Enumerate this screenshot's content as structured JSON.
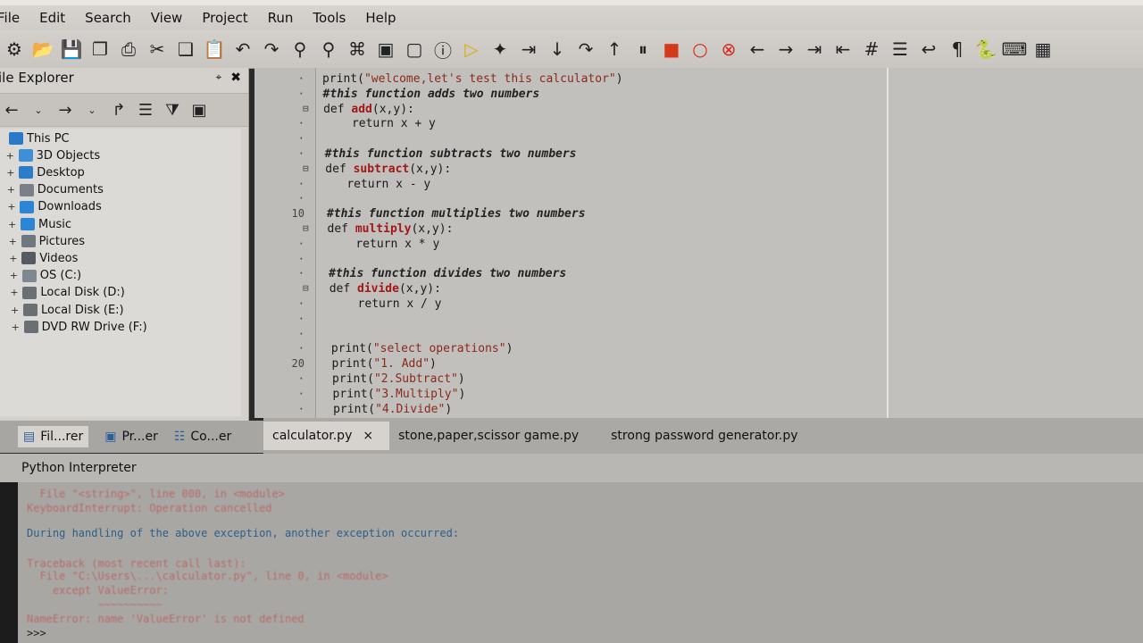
{
  "menu": [
    "File",
    "Edit",
    "Search",
    "View",
    "Project",
    "Run",
    "Tools",
    "Help"
  ],
  "toolbar_icons": [
    "new-project-icon",
    "open-icon",
    "save-icon",
    "save-all-icon",
    "print-icon",
    "cut-icon",
    "copy-icon",
    "paste-icon",
    "undo-icon",
    "redo-icon",
    "find-icon",
    "find-replace-icon",
    "find-in-files-icon",
    "screenshot-icon",
    "window-icon",
    "info-icon",
    "run-icon",
    "debug-icon",
    "step-icon",
    "step-into-icon",
    "step-over-icon",
    "step-out-icon",
    "pause-icon",
    "stop-icon",
    "breakpoint-icon",
    "clear-breakpoints-icon",
    "back-icon",
    "forward-icon",
    "indent-icon",
    "unindent-icon",
    "comment-icon",
    "list-icon",
    "wrap-icon",
    "pilcrow-icon",
    "python-icon",
    "keyboard-icon",
    "layout-icon"
  ],
  "explorer": {
    "title": "ile Explorer",
    "pin": "📌",
    "close": "✖",
    "tree": [
      {
        "label": "This PC",
        "depth": 0,
        "color": "#2a78c8"
      },
      {
        "label": "3D Objects",
        "depth": 1,
        "color": "#3c8fd8"
      },
      {
        "label": "Desktop",
        "depth": 1,
        "color": "#2d7cc8"
      },
      {
        "label": "Documents",
        "depth": 1,
        "color": "#7a7f88"
      },
      {
        "label": "Downloads",
        "depth": 1,
        "color": "#2b86d6"
      },
      {
        "label": "Music",
        "depth": 1,
        "color": "#2b86d6"
      },
      {
        "label": "Pictures",
        "depth": 1,
        "color": "#6f7780"
      },
      {
        "label": "Videos",
        "depth": 1,
        "color": "#555b60"
      },
      {
        "label": "OS (C:)",
        "depth": 1,
        "color": "#7f8890"
      },
      {
        "label": "Local Disk (D:)",
        "depth": 1,
        "color": "#6a6f74"
      },
      {
        "label": "Local Disk (E:)",
        "depth": 1,
        "color": "#6a6f74"
      },
      {
        "label": "DVD RW Drive (F:)",
        "depth": 1,
        "color": "#6a6f74"
      }
    ]
  },
  "editor": {
    "lines": [
      {
        "num": "",
        "fold": "",
        "parts": [
          [
            "print(",
            ""
          ],
          [
            "\"welcome,let's test this calculator\"",
            "str"
          ],
          [
            ")",
            ""
          ]
        ]
      },
      {
        "num": "",
        "fold": "",
        "parts": [
          [
            "#this function adds two numbers",
            "cmt"
          ]
        ]
      },
      {
        "num": "",
        "fold": "⊟",
        "parts": [
          [
            "def ",
            "kw"
          ],
          [
            "add",
            "fn"
          ],
          [
            "(x,y):",
            ""
          ]
        ]
      },
      {
        "num": "",
        "fold": "",
        "parts": [
          [
            "    return x + y",
            ""
          ]
        ]
      },
      {
        "num": "",
        "fold": "",
        "parts": [
          [
            "",
            ""
          ]
        ]
      },
      {
        "num": "",
        "fold": "",
        "parts": [
          [
            "#this function subtracts two numbers",
            "cmt"
          ]
        ]
      },
      {
        "num": "",
        "fold": "⊟",
        "parts": [
          [
            "def ",
            "kw"
          ],
          [
            "subtract",
            "fn"
          ],
          [
            "(x,y):",
            ""
          ]
        ]
      },
      {
        "num": "",
        "fold": "",
        "parts": [
          [
            "   return x - y",
            ""
          ]
        ]
      },
      {
        "num": "",
        "fold": "",
        "parts": [
          [
            "",
            ""
          ]
        ]
      },
      {
        "num": "10",
        "fold": "",
        "parts": [
          [
            "#this function multiplies two numbers",
            "cmt"
          ]
        ]
      },
      {
        "num": "",
        "fold": "⊟",
        "parts": [
          [
            "def ",
            "kw"
          ],
          [
            "multiply",
            "fn"
          ],
          [
            "(x,y):",
            ""
          ]
        ]
      },
      {
        "num": "",
        "fold": "",
        "parts": [
          [
            "    return x * y",
            ""
          ]
        ]
      },
      {
        "num": "",
        "fold": "",
        "parts": [
          [
            "",
            ""
          ]
        ]
      },
      {
        "num": "",
        "fold": "",
        "parts": [
          [
            "#this function divides two numbers",
            "cmt"
          ]
        ]
      },
      {
        "num": "",
        "fold": "⊟",
        "parts": [
          [
            "def ",
            "kw"
          ],
          [
            "divide",
            "fn"
          ],
          [
            "(x,y):",
            ""
          ]
        ]
      },
      {
        "num": "",
        "fold": "",
        "parts": [
          [
            "    return x / y",
            ""
          ]
        ]
      },
      {
        "num": "",
        "fold": "",
        "parts": [
          [
            "",
            ""
          ]
        ]
      },
      {
        "num": "",
        "fold": "",
        "parts": [
          [
            "",
            ""
          ]
        ]
      },
      {
        "num": "",
        "fold": "",
        "parts": [
          [
            "print(",
            ""
          ],
          [
            "\"select operations\"",
            "str"
          ],
          [
            ")",
            ""
          ]
        ]
      },
      {
        "num": "20",
        "fold": "",
        "parts": [
          [
            "print(",
            ""
          ],
          [
            "\"1. Add\"",
            "str"
          ],
          [
            ")",
            ""
          ]
        ]
      },
      {
        "num": "",
        "fold": "",
        "parts": [
          [
            "print(",
            ""
          ],
          [
            "\"2.Subtract\"",
            "str"
          ],
          [
            ")",
            ""
          ]
        ]
      },
      {
        "num": "",
        "fold": "",
        "parts": [
          [
            "print(",
            ""
          ],
          [
            "\"3.Multiply\"",
            "str"
          ],
          [
            ")",
            ""
          ]
        ]
      },
      {
        "num": "",
        "fold": "",
        "parts": [
          [
            "print(",
            ""
          ],
          [
            "\"4.Divide\"",
            "str"
          ],
          [
            ")",
            ""
          ]
        ]
      }
    ]
  },
  "left_tabs": [
    {
      "label": "Fil...rer",
      "icon": "file-explorer-icon",
      "active": true
    },
    {
      "label": "Pr...er",
      "icon": "project-icon",
      "active": false
    },
    {
      "label": "Co...er",
      "icon": "code-browser-icon",
      "active": false
    }
  ],
  "editor_tabs": [
    {
      "label": "calculator.py",
      "active": true,
      "close": "×"
    },
    {
      "label": "stone,paper,scissor game.py",
      "active": false,
      "close": ""
    },
    {
      "label": "strong password generator.py",
      "active": false,
      "close": ""
    }
  ],
  "interpreter": {
    "title": "Python Interpreter",
    "lines": [
      {
        "text": "  File \"<string>\", line 000, in <module>",
        "cls": "err"
      },
      {
        "text": "KeyboardInterrupt: Operation cancelled",
        "cls": "err"
      },
      {
        "text": "",
        "cls": ""
      },
      {
        "text": "During handling of the above exception, another exception occurred:",
        "cls": "info"
      },
      {
        "text": "",
        "cls": ""
      },
      {
        "text": "Traceback (most recent call last):",
        "cls": "err"
      },
      {
        "text": "  File \"C:\\Users\\...\\calculator.py\", line 0, in <module>",
        "cls": "err"
      },
      {
        "text": "    except ValueError:",
        "cls": "err"
      },
      {
        "text": "           ~~~~~~~~~~",
        "cls": "err"
      },
      {
        "text": "NameError: name 'ValueError' is not defined",
        "cls": "err"
      },
      {
        "text": ">>>",
        "cls": "prompt"
      }
    ]
  }
}
